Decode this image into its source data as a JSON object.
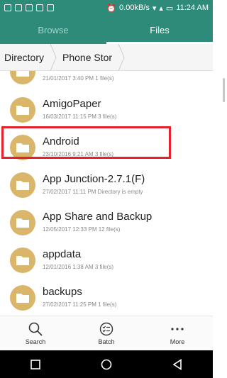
{
  "status": {
    "speed": "0.00kB/s",
    "time": "11:24 AM"
  },
  "tabs": [
    {
      "label": "Browse",
      "active": false
    },
    {
      "label": "Files",
      "active": true
    }
  ],
  "breadcrumb": [
    "Directory",
    "Phone Stor"
  ],
  "files": [
    {
      "name": "",
      "meta": "21/01/2017 3:40 PM  1 file(s)"
    },
    {
      "name": "AmigoPaper",
      "meta": "16/03/2017 11:15 PM  3 file(s)"
    },
    {
      "name": "Android",
      "meta": "23/10/2016 9:21 AM  3 file(s)"
    },
    {
      "name": "App Junction-2.7.1(F)",
      "meta": "27/02/2017 11:11 PM  Directory is empty"
    },
    {
      "name": "App Share and Backup",
      "meta": "12/05/2017 12:33 PM  12 file(s)"
    },
    {
      "name": "appdata",
      "meta": "12/01/2016 1:38 AM  3 file(s)"
    },
    {
      "name": "backups",
      "meta": "27/02/2017 11:25 PM  1 file(s)"
    }
  ],
  "bottom": {
    "search": "Search",
    "batch": "Batch",
    "more": "More"
  },
  "colors": {
    "accent": "#2e8b7a",
    "folder": "#d9b66a",
    "highlight": "#e6212e"
  }
}
